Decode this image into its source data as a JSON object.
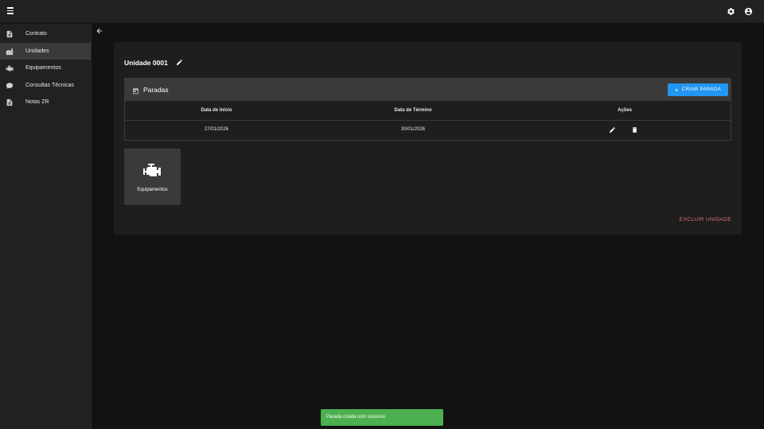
{
  "sidebar": {
    "items": [
      {
        "label": "Contrato",
        "icon": "document-icon"
      },
      {
        "label": "Unidades",
        "icon": "factory-icon"
      },
      {
        "label": "Equipamentos",
        "icon": "engine-icon"
      },
      {
        "label": "Consultas Técnicas",
        "icon": "chat-icon"
      },
      {
        "label": "Notas ZR",
        "icon": "notes-icon"
      }
    ],
    "active_index": 1
  },
  "unit": {
    "title": "Unidade 0001"
  },
  "paradas": {
    "title": "Paradas",
    "create_button": "CRIAR PARADA",
    "columns": [
      "Data de Início",
      "Data de Término",
      "Ações"
    ],
    "rows": [
      {
        "start": "27/01/2026",
        "end": "30/01/2026"
      }
    ]
  },
  "equipment_tile": {
    "label": "Equipamentos"
  },
  "delete_unit_button": "EXCLUIR UNIDADE",
  "toast": {
    "message": "Parada criada com sucesso"
  },
  "colors": {
    "accent": "#2196f3",
    "danger": "#e57373",
    "success": "#4caf50",
    "background": "#121212",
    "surface": "#212121"
  }
}
